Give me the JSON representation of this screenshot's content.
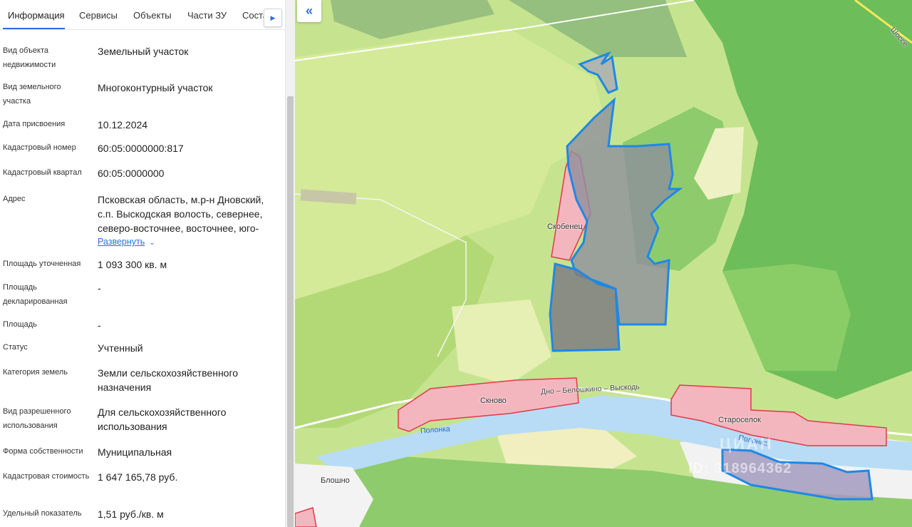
{
  "tabs": [
    {
      "label": "Информация"
    },
    {
      "label": "Сервисы"
    },
    {
      "label": "Объекты"
    },
    {
      "label": "Части ЗУ"
    },
    {
      "label": "Соста"
    }
  ],
  "tab_scroll_icon": "triangle-right-icon",
  "fields": {
    "object_type": {
      "label": "Вид объекта недвижимости",
      "value": "Земельный участок"
    },
    "land_type": {
      "label": "Вид земельного участка",
      "value": "Многоконтурный участок"
    },
    "assign_date": {
      "label": "Дата присвоения",
      "value": "10.12.2024"
    },
    "cadastral_number": {
      "label": "Кадастровый номер",
      "value": "60:05:0000000:817"
    },
    "cadastral_quarter": {
      "label": "Кадастровый квартал",
      "value": "60:05:0000000"
    },
    "address": {
      "label": "Адрес",
      "line1": "Псковская область, м.р-н Дновский,",
      "line2": "с.п. Выскодская волость, севернее,",
      "line3": "северо-восточнее, восточнее, юго-",
      "expand_label": "Развернуть"
    },
    "area_refined": {
      "label": "Площадь уточненная",
      "value": "1 093 300 кв. м"
    },
    "area_declared": {
      "label": "Площадь декларированная",
      "value": "-"
    },
    "area": {
      "label": "Площадь",
      "value": "-"
    },
    "status": {
      "label": "Статус",
      "value": "Учтенный"
    },
    "land_category": {
      "label": "Категория земель",
      "value": "Земли сельскохозяйственного назначения"
    },
    "permitted_use": {
      "label": "Вид разрешенного использования",
      "value": "Для сельскохозяйственного использования"
    },
    "ownership": {
      "label": "Форма собственности",
      "value": "Муниципальная"
    },
    "cadastral_value": {
      "label": "Кадастровая стоимость",
      "value": "1 647 165,78 руб."
    },
    "unit_value": {
      "label": "Удельный показатель",
      "value": "1,51 руб./кв. м"
    }
  },
  "map": {
    "collapse_icon": "double-chevron-left-icon",
    "labels": {
      "skobenets": "Скобенец",
      "sknovo": "Скново",
      "staroselok": "Староселок",
      "blosno": "Блошно",
      "road": "Дно – Белошкино – Выскодь",
      "river1": "Полонка",
      "river2": "Полонка",
      "highway": "Шоссе"
    },
    "watermark_top": "ЦИАН",
    "watermark_id": "ID: 318964362",
    "colors": {
      "parcel_outline": "#1e88e5",
      "settlement_fill": "#f4b6be",
      "settlement_outline": "#e0384b",
      "river": "#b8dcf5",
      "forest": "#6dbd5b"
    }
  }
}
